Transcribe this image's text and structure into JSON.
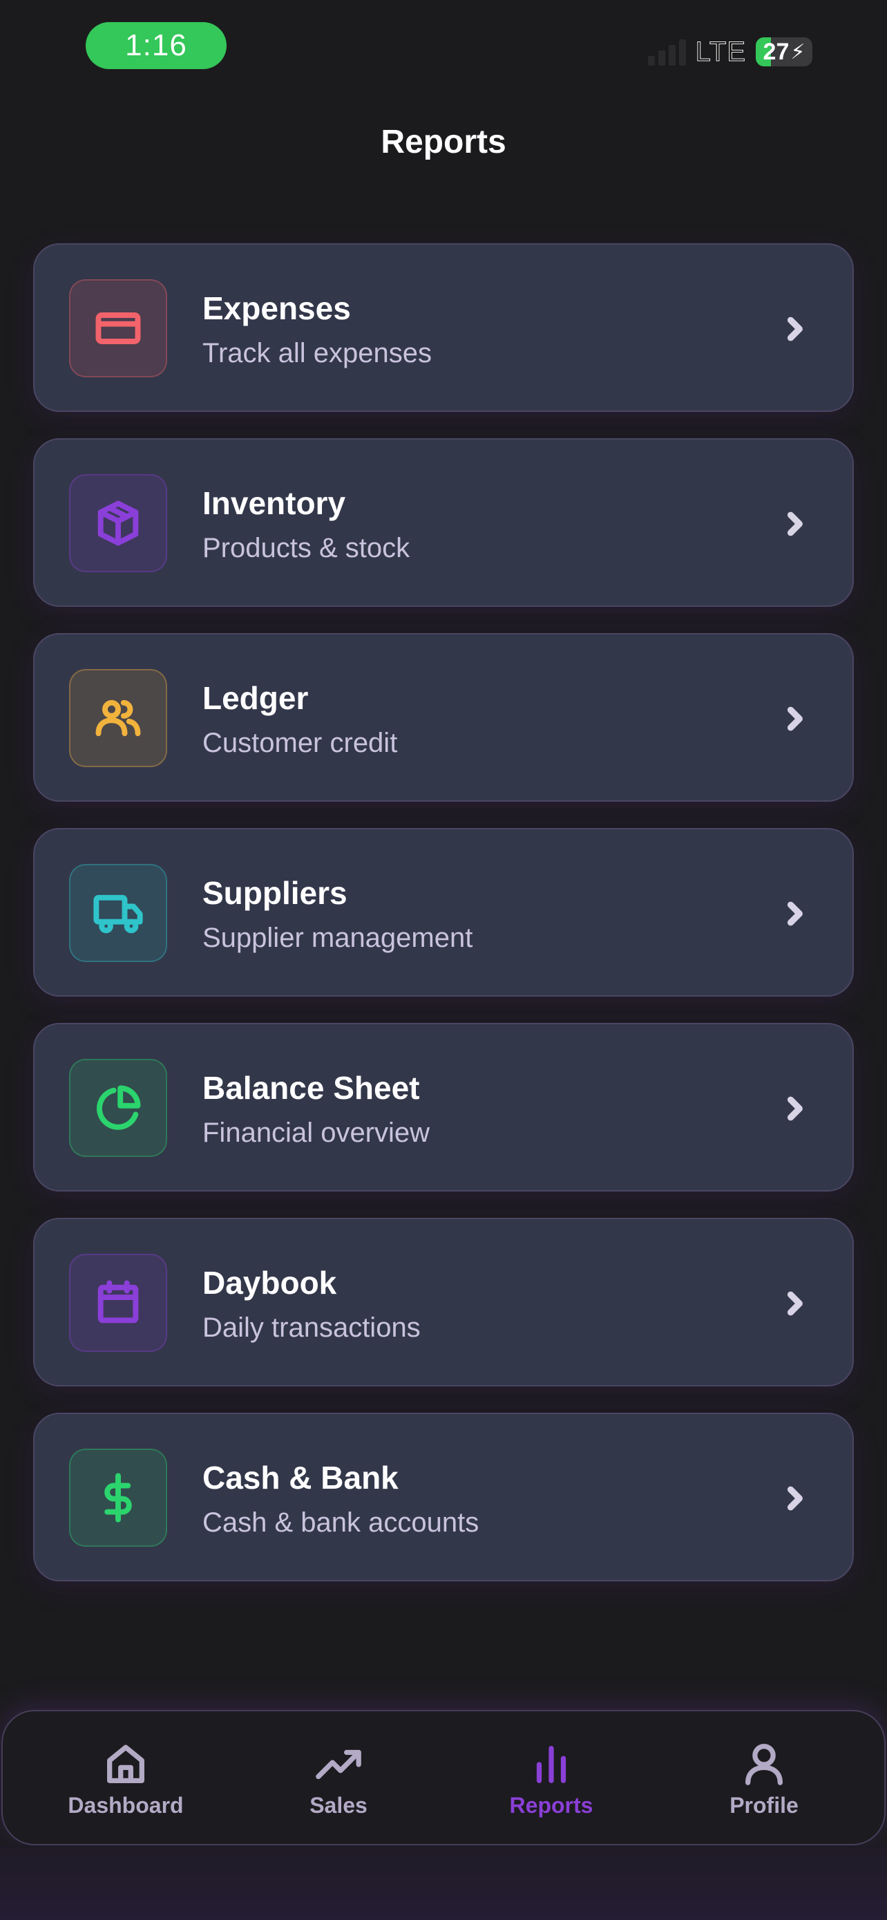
{
  "status_bar": {
    "time": "1:16",
    "network": "LTE",
    "battery_level": "27",
    "battery_fraction": 0.27
  },
  "header": {
    "title": "Reports"
  },
  "colors": {
    "background": "#1b1b1d",
    "card": "#33374a",
    "card_border": "#4a4663",
    "accent": "#8a3fd6",
    "inactive": "#b3aac6"
  },
  "reports": [
    {
      "title": "Expenses",
      "subtitle": "Track all expenses",
      "icon": "credit-card-icon",
      "color": "#f2636b"
    },
    {
      "title": "Inventory",
      "subtitle": "Products & stock",
      "icon": "package-icon",
      "color": "#8b3fd9"
    },
    {
      "title": "Ledger",
      "subtitle": "Customer credit",
      "icon": "users-icon",
      "color": "#f2b33d"
    },
    {
      "title": "Suppliers",
      "subtitle": "Supplier management",
      "icon": "truck-icon",
      "color": "#2ec4c9"
    },
    {
      "title": "Balance Sheet",
      "subtitle": "Financial overview",
      "icon": "pie-chart-icon",
      "color": "#2bd46d"
    },
    {
      "title": "Daybook",
      "subtitle": "Daily transactions",
      "icon": "calendar-icon",
      "color": "#8b3fd9"
    },
    {
      "title": "Cash & Bank",
      "subtitle": "Cash & bank accounts",
      "icon": "dollar-icon",
      "color": "#2bd46d"
    }
  ],
  "nav": {
    "items": [
      {
        "label": "Dashboard",
        "icon": "home-icon"
      },
      {
        "label": "Sales",
        "icon": "trending-up-icon"
      },
      {
        "label": "Reports",
        "icon": "bar-chart-icon"
      },
      {
        "label": "Profile",
        "icon": "user-icon"
      }
    ],
    "active": "Reports"
  }
}
